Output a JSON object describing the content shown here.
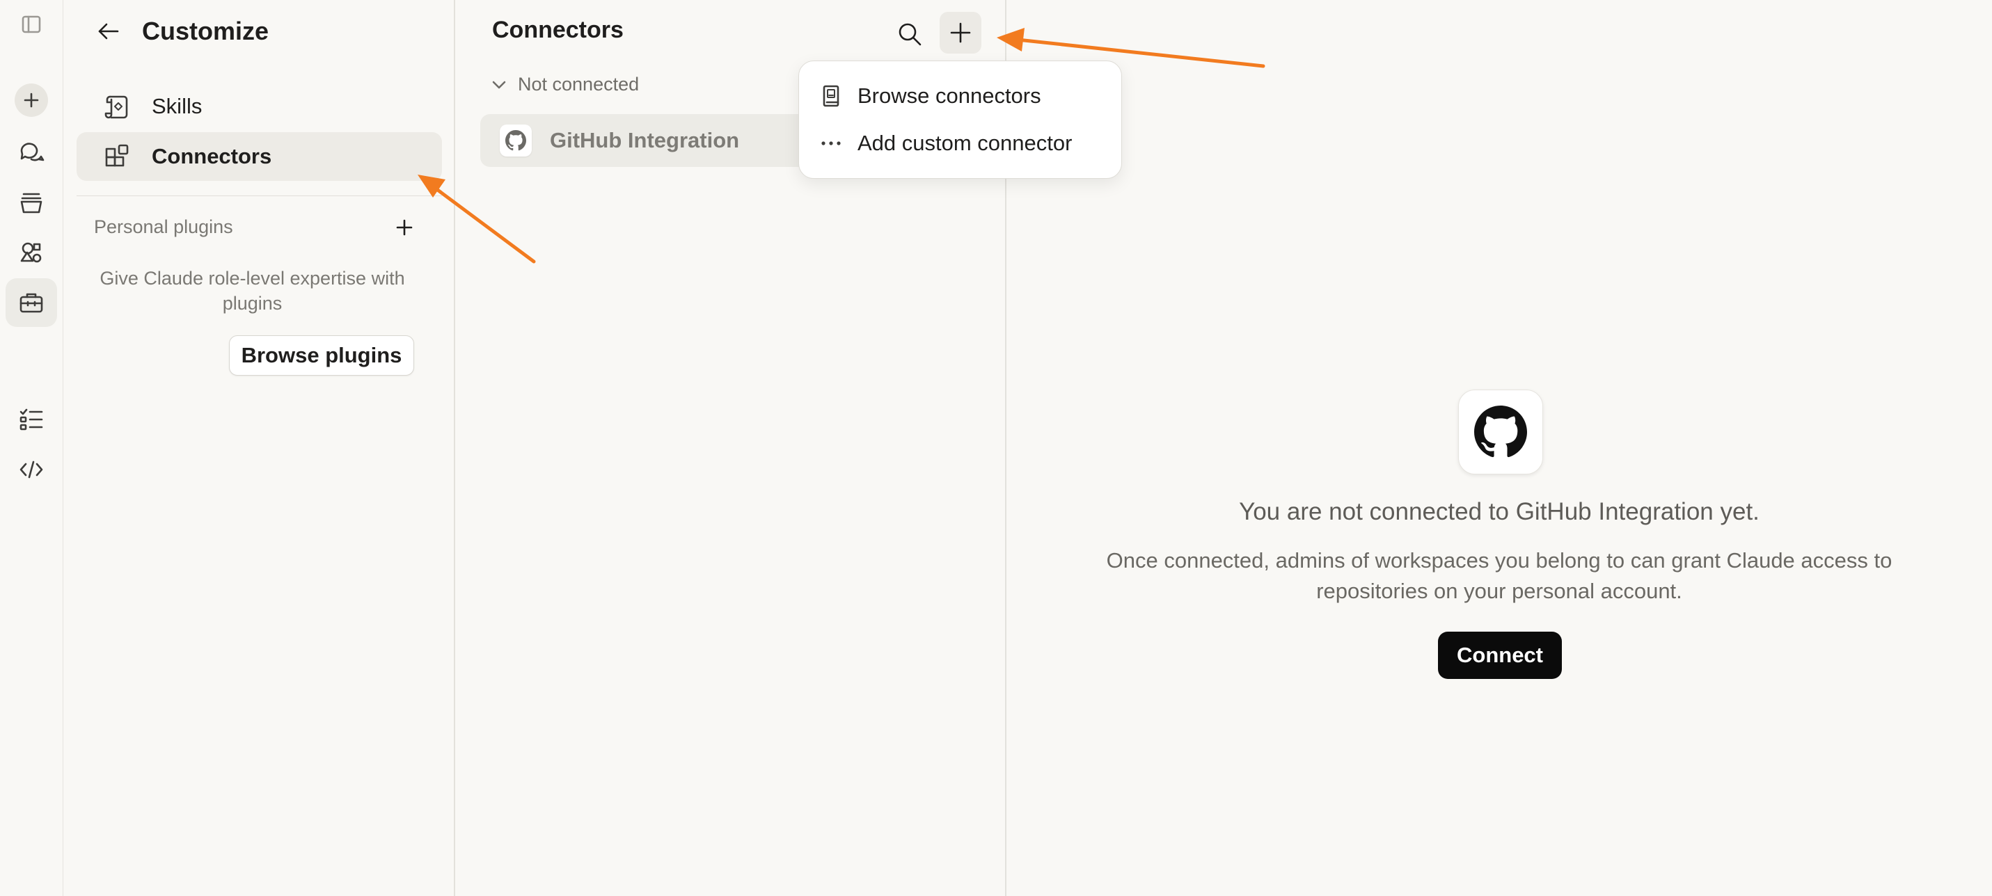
{
  "customize": {
    "title": "Customize",
    "nav": [
      {
        "label": "Skills",
        "icon": "scroll-icon"
      },
      {
        "label": "Connectors",
        "icon": "connectors-icon"
      }
    ],
    "personal_plugins_label": "Personal plugins",
    "plugins_description": "Give Claude role-level expertise with plugins",
    "browse_plugins_label": "Browse plugins"
  },
  "connectors": {
    "title": "Connectors",
    "group_label": "Not connected",
    "items": [
      {
        "label": "GitHub Integration",
        "icon": "github-icon"
      }
    ]
  },
  "dropdown": {
    "items": [
      {
        "label": "Browse connectors",
        "icon": "book-icon"
      },
      {
        "label": "Add custom connector",
        "icon": "more-dots-icon"
      }
    ]
  },
  "detail": {
    "headline": "You are not connected to GitHub Integration yet.",
    "body": "Once connected, admins of workspaces you belong to can grant Claude access to repositories on your personal account.",
    "connect_label": "Connect"
  },
  "colors": {
    "background": "#f9f8f5",
    "active_item": "#edebe6",
    "annotation_arrow": "#f27b1f",
    "connect_button": "#0b0b0b"
  }
}
